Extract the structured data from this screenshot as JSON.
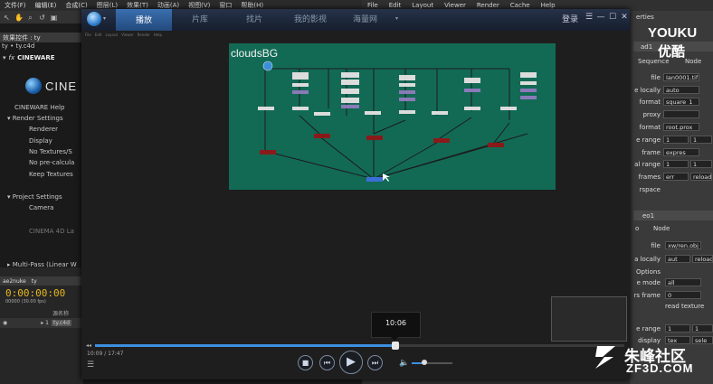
{
  "ae": {
    "menu": [
      "文件(F)",
      "编辑(E)",
      "合成(C)",
      "图层(L)",
      "效果(T)",
      "动画(A)",
      "视图(V)",
      "窗口",
      "帮助(H)"
    ],
    "panel_tabs": [
      "效果控件 : ty"
    ],
    "breadcrumb": "ty • ty.c4d",
    "fx_name": "CINEWARE",
    "logo_text": "CINE",
    "props": [
      {
        "label": "CINEWARE Help",
        "indent": 2
      },
      {
        "label": "▾ Render Settings",
        "indent": 1
      },
      {
        "label": "Renderer",
        "indent": 4
      },
      {
        "label": "Display",
        "indent": 4
      },
      {
        "label": "No Textures/S",
        "indent": 4
      },
      {
        "label": "No pre-calcula",
        "indent": 4
      },
      {
        "label": "Keep Textures",
        "indent": 4
      },
      {
        "label": "▾ Project Settings",
        "indent": 1
      },
      {
        "label": "Camera",
        "indent": 4
      },
      {
        "label": "CINEMA 4D La",
        "indent": 4
      },
      {
        "label": "▸ Multi-Pass (Linear W",
        "indent": 1
      }
    ],
    "timeline_tabs": [
      "ae2nuke",
      "ty"
    ],
    "timecode": "0:00:00:00",
    "fps": "00000 (30.00 fps)",
    "layer_header": "源名称",
    "layer_name": "ty.c4d"
  },
  "nuke": {
    "menu": [
      "File",
      "Edit",
      "Layout",
      "Viewer",
      "Render",
      "Cache",
      "Help"
    ],
    "props_tab": "erties",
    "read_node1": "ad1",
    "tabs1": [
      "Sequence",
      "Node"
    ],
    "rows1": [
      {
        "label": "file",
        "value": "Ian0001.tif"
      },
      {
        "label": "e locally",
        "value": "auto"
      },
      {
        "label": "format",
        "value": "square_1"
      },
      {
        "label": "proxy",
        "value": ""
      },
      {
        "label": "format",
        "value": "root.prox"
      },
      {
        "label": "e range",
        "value": "1",
        "value2": "1"
      },
      {
        "label": "frame",
        "value": "expres"
      },
      {
        "label": "al range",
        "value": "1",
        "value2": "1"
      },
      {
        "label": "frames",
        "value": "err",
        "value2": "reload"
      },
      {
        "label": "rspace",
        "value": ""
      }
    ],
    "read_node2": "eo1",
    "tabs2": [
      "o",
      "Node"
    ],
    "rows2": [
      {
        "label": "file",
        "value": "xw/ren.obj"
      },
      {
        "label": "a locally",
        "value": "aut",
        "value2": "reload"
      },
      {
        "label": "Options",
        "value": ""
      },
      {
        "label": "e mode",
        "value": "all"
      },
      {
        "label": "rs frame",
        "value": "0"
      },
      {
        "label": "",
        "value": "read texture"
      },
      {
        "label": "e range",
        "value": "1",
        "value2": "1"
      },
      {
        "label": "display",
        "value": "tex",
        "value2": "sele"
      }
    ]
  },
  "player": {
    "tabs": [
      "播放",
      "片库",
      "找片",
      "我的影视",
      "海量网"
    ],
    "active_tab": "播放",
    "login_label": "登录",
    "window_controls": [
      "☰",
      "—",
      "☐",
      "✕"
    ],
    "tooltip_time": "10:06",
    "current_time": "10:09 / 17:47",
    "progress": 0.568,
    "volume": 0.3,
    "nodegraph_title": "cloudsBG",
    "colors": {
      "accent": "#3d8fe0",
      "graph_bg": "#126a55"
    }
  },
  "icons": {
    "stop": "■",
    "prev": "⏮",
    "play": "▶",
    "next": "⏭",
    "volume": "🔈",
    "playlist": "☰",
    "collapse": "◂◂"
  },
  "watermark": {
    "youku": "YOUKU",
    "youku_cn": "优酷",
    "zf_cn": "朱峰社区",
    "zf_url": "ZF3D.COM"
  }
}
